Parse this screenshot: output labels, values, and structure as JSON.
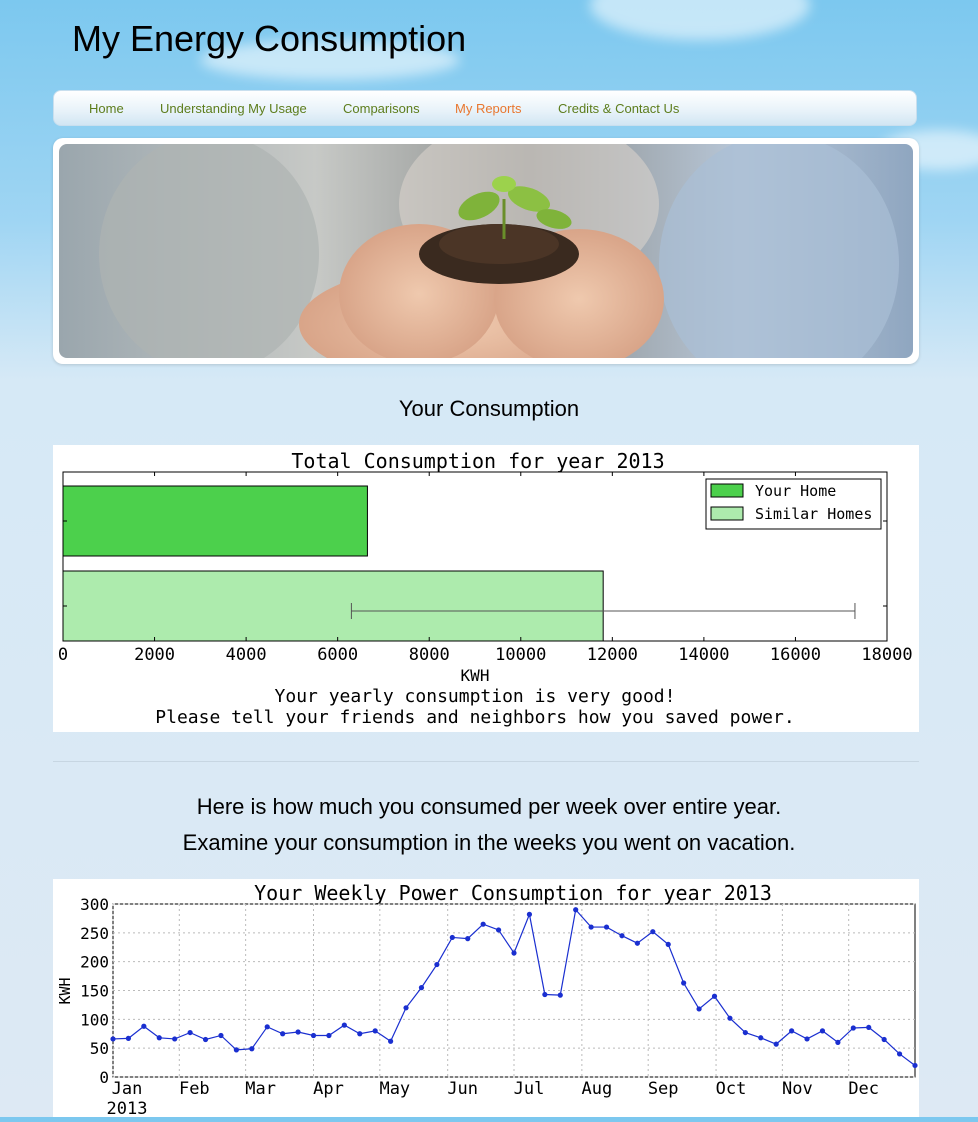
{
  "site": {
    "title": "My Energy Consumption"
  },
  "nav": {
    "items": [
      {
        "label": "Home",
        "active": false
      },
      {
        "label": "Understanding My Usage",
        "active": false
      },
      {
        "label": "Comparisons",
        "active": false
      },
      {
        "label": "My Reports",
        "active": true
      },
      {
        "label": "Credits & Contact Us",
        "active": false
      }
    ],
    "color": "#5d7d1c",
    "active_color": "#e9772f"
  },
  "banner": {
    "alt_icon": "hands-holding-seedling-photo"
  },
  "section1": {
    "heading": "Your Consumption"
  },
  "section2": {
    "heading_line1": "Here is how much you consumed per week over entire year.",
    "heading_line2": "Examine your consumption in the weeks you went on vacation."
  },
  "chart_data": [
    {
      "type": "bar",
      "orientation": "horizontal",
      "title": "Total Consumption for year 2013",
      "xlabel": "KWH",
      "xlim": [
        0,
        18000
      ],
      "xticks": [
        "0",
        "2000",
        "4000",
        "6000",
        "8000",
        "10000",
        "12000",
        "14000",
        "16000",
        "18000"
      ],
      "series": [
        {
          "name": "Your Home",
          "value": 6650,
          "color": "#4cd04c"
        },
        {
          "name": "Similar Homes",
          "value": 11800,
          "error_range": [
            6300,
            17300
          ],
          "color": "#adebad"
        }
      ],
      "legend_position": "top-right",
      "caption_line1": "Your yearly consumption is very good!",
      "caption_line2": "Please tell your friends and neighbors how you saved power."
    },
    {
      "type": "line",
      "title": "Your Weekly Power Consumption for year 2013",
      "ylabel": "KWH",
      "ylim": [
        0,
        300
      ],
      "yticks": [
        "0",
        "50",
        "100",
        "150",
        "200",
        "250",
        "300"
      ],
      "xlabels": [
        "Jan\n2013",
        "Feb",
        "Mar",
        "Apr",
        "May",
        "Jun",
        "Jul",
        "Aug",
        "Sep",
        "Oct",
        "Nov",
        "Dec"
      ],
      "grid": true,
      "color": "#1a2fd0",
      "values": [
        66,
        67,
        88,
        68,
        66,
        77,
        65,
        72,
        47,
        49,
        87,
        75,
        78,
        72,
        72,
        90,
        75,
        80,
        62,
        120,
        155,
        195,
        242,
        240,
        265,
        255,
        215,
        282,
        143,
        142,
        290,
        260,
        260,
        245,
        232,
        252,
        230,
        163,
        118,
        140,
        102,
        77,
        68,
        57,
        80,
        66,
        80,
        60,
        85,
        86,
        65,
        40,
        20
      ]
    }
  ]
}
